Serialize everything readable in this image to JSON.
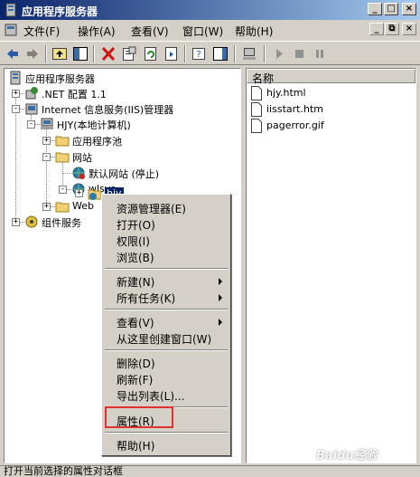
{
  "window": {
    "title": "应用程序服务器",
    "buttons": {
      "minimize": "_",
      "maximize": "□",
      "close": "×"
    }
  },
  "menubar": {
    "items": [
      "文件(F)",
      "操作(A)",
      "查看(V)",
      "窗口(W)",
      "帮助(H)"
    ],
    "mdi_buttons": {
      "minimize": "_",
      "restore": "⧉",
      "close": "×"
    }
  },
  "tree": {
    "root": "应用程序服务器",
    "net": ".NET 配置 1.1",
    "iis": "Internet 信息服务(IIS)管理器",
    "computer": "HJY(本地计算机)",
    "apppools": "应用程序池",
    "websites": "网站",
    "default_site": "默认网站 (停止)",
    "wlsys": "wlsys",
    "hjy": "hjy",
    "web": "Web",
    "components": "组件服务"
  },
  "list": {
    "column": "名称",
    "files": [
      "hjy.html",
      "iisstart.htm",
      "pagerror.gif"
    ]
  },
  "context_menu": {
    "explore": "资源管理器(E)",
    "open": "打开(O)",
    "permissions": "权限(I)",
    "browse": "浏览(B)",
    "new": "新建(N)",
    "all_tasks": "所有任务(K)",
    "view": "查看(V)",
    "new_window": "从这里创建窗口(W)",
    "delete": "删除(D)",
    "refresh": "刷新(F)",
    "export": "导出列表(L)...",
    "properties": "属性(R)",
    "help": "帮助(H)"
  },
  "status": {
    "text": "打开当前选择的属性对话框"
  },
  "watermark": "Baidu经验",
  "colors": {
    "title_bar": "#0a246a",
    "selection": "#0a246a",
    "highlight": "#e03030",
    "face": "#d4d0c8"
  }
}
